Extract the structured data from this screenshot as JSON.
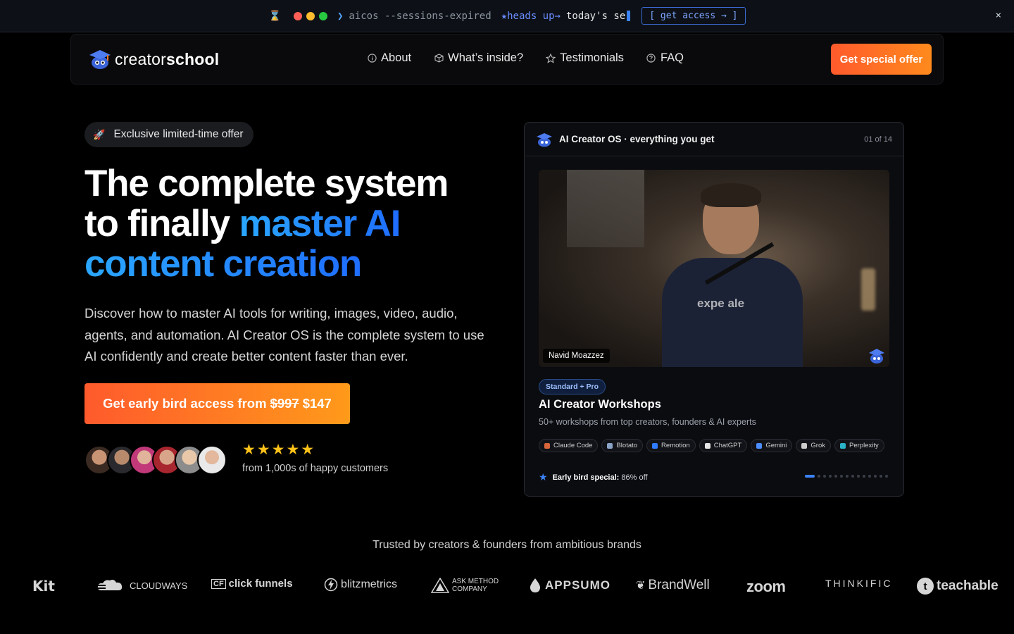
{
  "topbar": {
    "command": "aicos --sessions-expired",
    "heads_up": "★heads up→",
    "typing": "today's se",
    "get_access": "[ get access → ]",
    "close": "×"
  },
  "nav": {
    "logo_regular": "creator",
    "logo_bold": "school",
    "links": [
      {
        "label": "About",
        "icon": "info-icon"
      },
      {
        "label": "What’s inside?",
        "icon": "box-icon"
      },
      {
        "label": "Testimonials",
        "icon": "star-icon"
      },
      {
        "label": "FAQ",
        "icon": "help-icon"
      }
    ],
    "cta": "Get special offer"
  },
  "hero": {
    "badge": "Exclusive limited-time offer",
    "headline_line1": "The complete system",
    "headline_line2_plain": "to finally ",
    "headline_line2_blue": "master AI",
    "headline_line3_blue": "content creation",
    "subtext": "Discover how to master AI tools for writing, images, video, audio, agents, and automation. AI Creator OS is the complete system to use AI confidently and create better content faster than ever.",
    "cta_prefix": "Get early bird access from",
    "cta_old_price": "$997",
    "cta_new_price": "$147",
    "stars": "★★★★★",
    "rating": 5,
    "happy_customers": "from 1,000s of happy customers"
  },
  "card": {
    "title": "AI Creator OS · everything you get",
    "count": "01 of 14",
    "presenter": "Navid Moazzez",
    "shirt_text": "expe  ale",
    "tier": "Standard + Pro",
    "workshop_title": "AI Creator Workshops",
    "workshop_sub": "50+ workshops from top creators, founders & AI experts",
    "tools": [
      {
        "label": "Claude Code",
        "color": "#d9663b"
      },
      {
        "label": "Blotato",
        "color": "#8aa4c8"
      },
      {
        "label": "Remotion",
        "color": "#2f7bff"
      },
      {
        "label": "ChatGPT",
        "color": "#e6e6e6"
      },
      {
        "label": "Gemini",
        "color": "#4c8dff"
      },
      {
        "label": "Grok",
        "color": "#cccccc"
      },
      {
        "label": "Perplexity",
        "color": "#2ab3c6"
      }
    ],
    "early_label": "Early bird special:",
    "early_value": "86% off",
    "page_index": 1,
    "page_total": 14
  },
  "trusted": {
    "caption": "Trusted by creators & founders from ambitious brands",
    "brands": [
      "Kit",
      "CLOUDWAYS",
      "click funnels",
      "blitzmetrics",
      "ASK METHOD COMPANY",
      "APPSUMO",
      "BrandWell",
      "zoom",
      "THINKIFIC",
      "teachable"
    ]
  },
  "colors": {
    "accent_orange": "#ff6a24",
    "accent_blue": "#1f8cff",
    "background": "#000000"
  }
}
